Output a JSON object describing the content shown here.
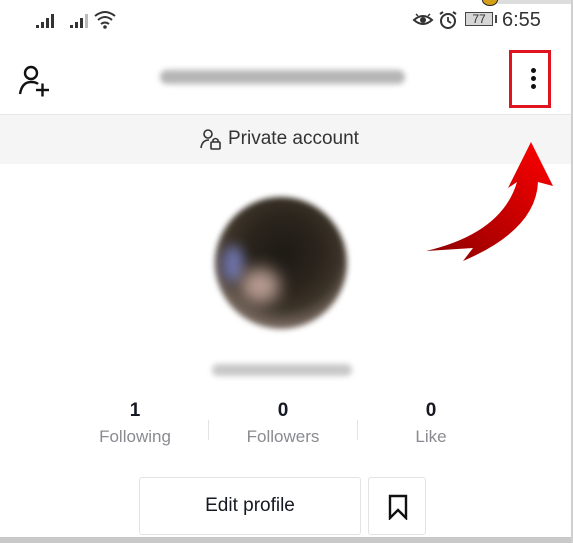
{
  "status_bar": {
    "time": "6:55",
    "battery": "77",
    "icons": [
      "signal-icon",
      "signal-icon",
      "wifi-icon",
      "eye-icon",
      "alarm-icon",
      "battery-icon"
    ]
  },
  "header": {
    "username_blurred": "",
    "add_user_icon": "add-user-icon",
    "more_icon": "more-vertical-icon"
  },
  "private_banner": {
    "icon": "person-lock-icon",
    "label": "Private account"
  },
  "profile": {
    "handle_blurred": ""
  },
  "stats": [
    {
      "value": "1",
      "label": "Following"
    },
    {
      "value": "0",
      "label": "Followers"
    },
    {
      "value": "0",
      "label": "Like"
    }
  ],
  "actions": {
    "edit_profile": "Edit profile",
    "bookmark_icon": "bookmark-icon"
  },
  "annotation": {
    "highlight_color": "#e0141e",
    "arrow_color": "#cc0000"
  }
}
